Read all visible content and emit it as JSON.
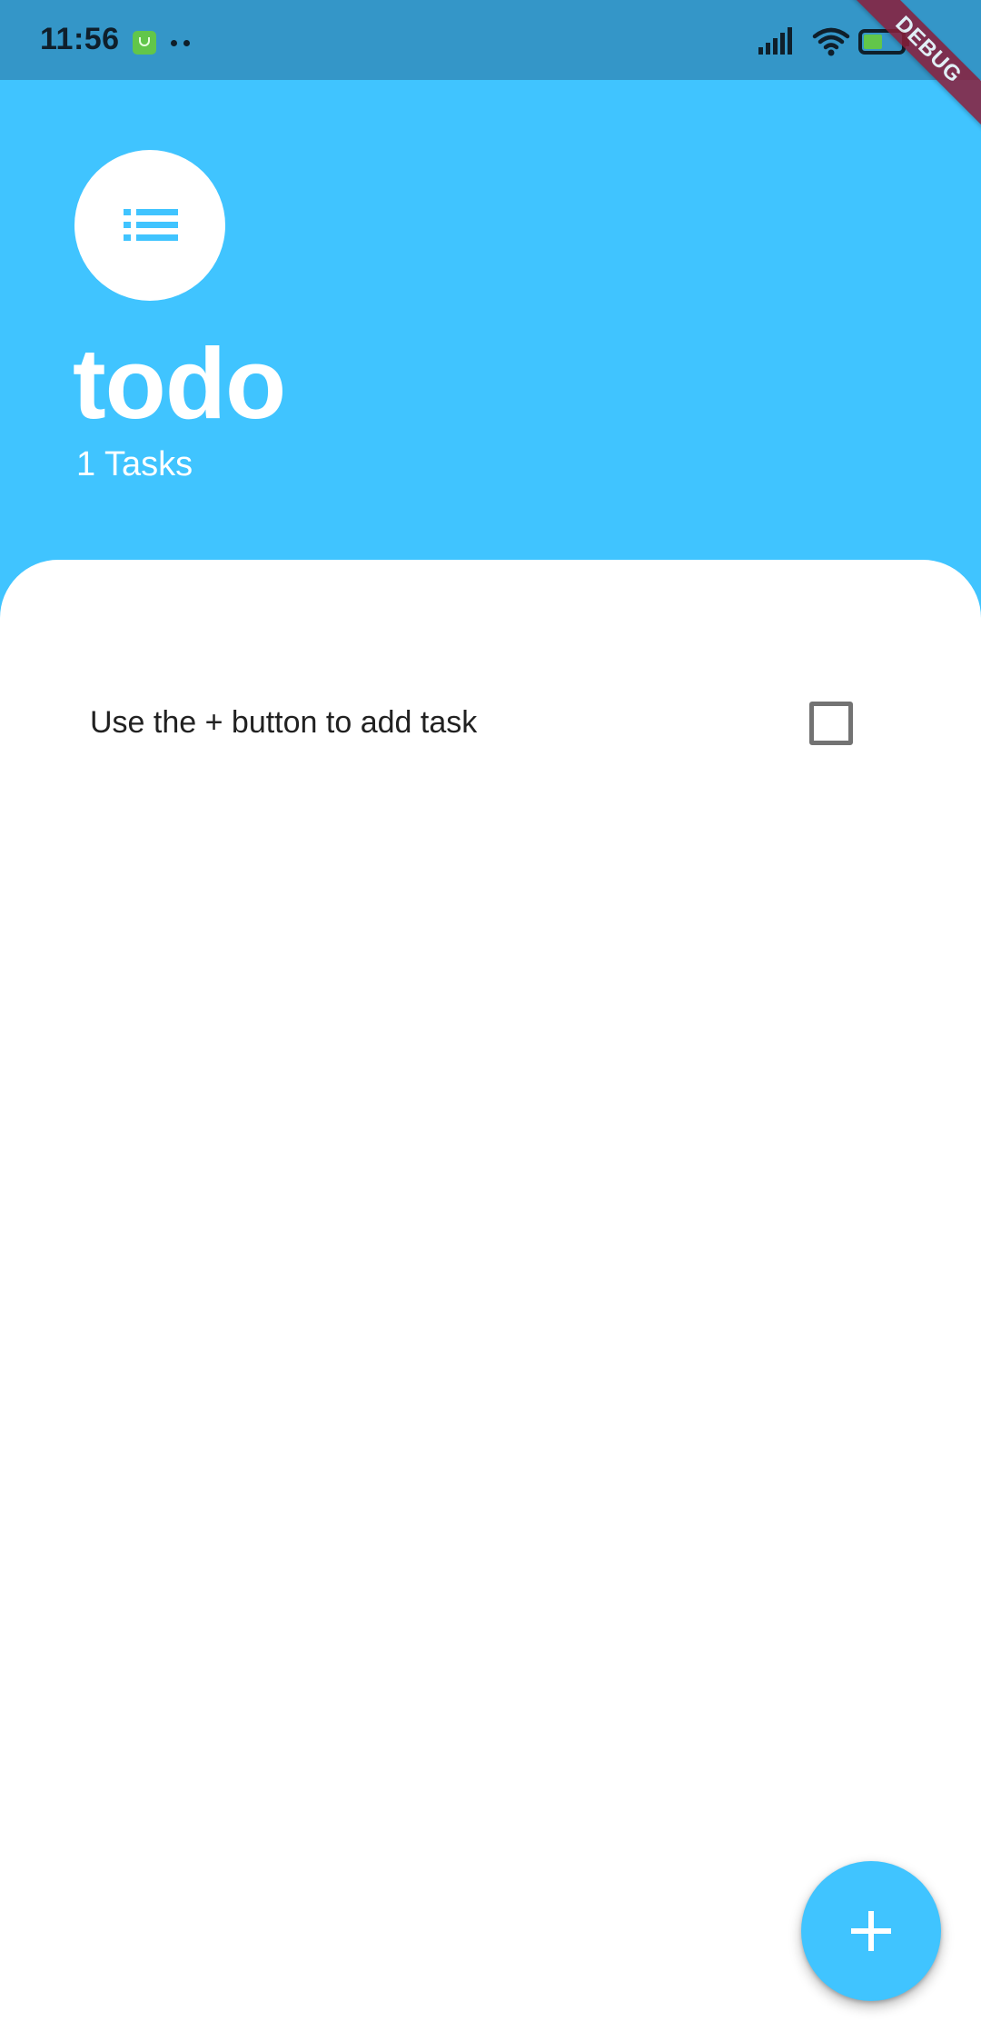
{
  "status_bar": {
    "time": "11:56",
    "debug_label": "DEBUG"
  },
  "header": {
    "title": "todo",
    "task_count": "1 Tasks",
    "avatar_icon": "list-icon"
  },
  "tasks": [
    {
      "text": "Use the + button to add task",
      "checked": false
    }
  ],
  "fab": {
    "icon": "plus-icon"
  },
  "colors": {
    "primary": "#40C4FF",
    "status_bar": "#3496C8",
    "surface": "#FFFFFF",
    "text": "#212121",
    "checkbox_border": "#737373",
    "debug_ribbon": "#8A1E3A"
  }
}
